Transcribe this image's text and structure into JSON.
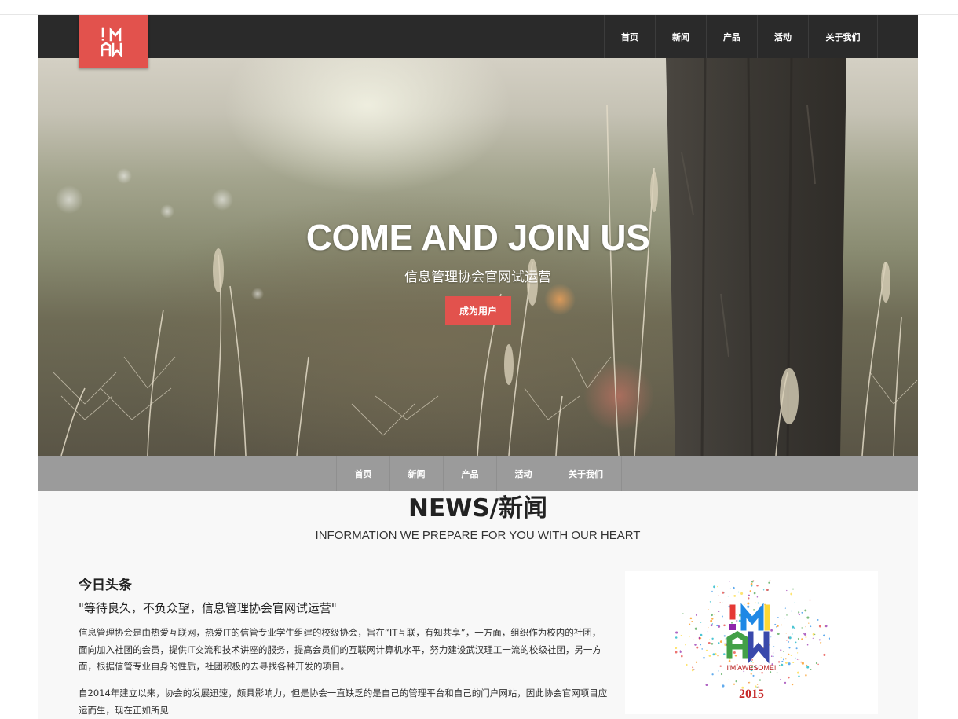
{
  "logo": {
    "text": "I'M AW",
    "icon": "im-aw-logo"
  },
  "nav": {
    "items": [
      "首页",
      "新闻",
      "产品",
      "活动",
      "关于我们"
    ]
  },
  "hero": {
    "title": "COME AND JOIN US",
    "subtitle": "信息管理协会官网试运营",
    "button_label": "成为用户"
  },
  "subnav": {
    "items": [
      "首页",
      "新闻",
      "产品",
      "活动",
      "关于我们"
    ]
  },
  "news": {
    "title": "NEWS/新闻",
    "subtitle": "INFORMATION WE PREPARE FOR YOU WITH OUR HEART",
    "headline_label": "今日头条",
    "headline_title": "\"等待良久，不负众望，信息管理协会官网试运营\"",
    "paragraph1": "信息管理协会是由热爱互联网，热爱IT的信管专业学生组建的校级协会，旨在“IT互联，有知共享”，一方面，组织作为校内的社团，面向加入社团的会员，提供IT交流和技术讲座的服务，提高会员们的互联网计算机水平，努力建设武汉理工一流的校级社团，另一方面，根据信管专业自身的性质，社团积极的去寻找各种开发的项目。",
    "paragraph2": "自2014年建立以来，协会的发展迅速，颇具影响力，但是协会一直缺乏的是自己的管理平台和自己的门户网站，因此协会官网项目应运而生，现在正如所见",
    "image": {
      "caption": "I'M AWESOME!",
      "year": "2015"
    }
  },
  "colors": {
    "accent": "#e2524d",
    "navbar": "#2a2a2a",
    "subnav": "#9b9b9b",
    "background": "#f8f8f8"
  }
}
